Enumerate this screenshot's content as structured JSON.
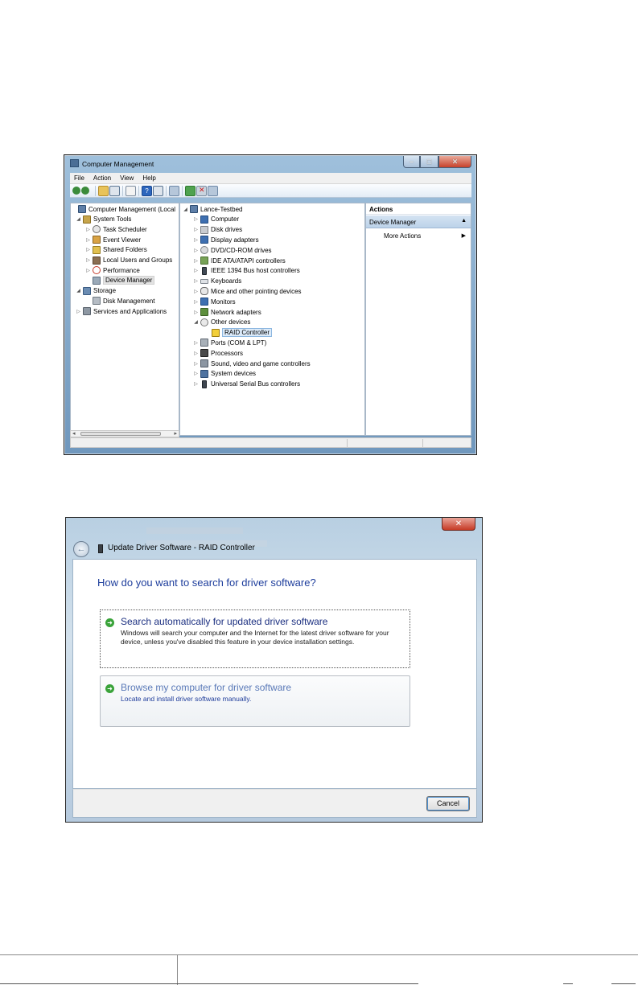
{
  "computer_management": {
    "title": "Computer Management",
    "menu": [
      "File",
      "Action",
      "View",
      "Help"
    ],
    "left_tree": [
      {
        "label": "Computer Management (Local",
        "level": 0,
        "expander": "",
        "icon": "computer-icon"
      },
      {
        "label": "System Tools",
        "level": 1,
        "expander": "◢",
        "icon": "tools-icon"
      },
      {
        "label": "Task Scheduler",
        "level": 2,
        "expander": "▷",
        "icon": "clock-icon"
      },
      {
        "label": "Event Viewer",
        "level": 2,
        "expander": "▷",
        "icon": "event-log-icon"
      },
      {
        "label": "Shared Folders",
        "level": 2,
        "expander": "▷",
        "icon": "shared-folder-icon"
      },
      {
        "label": "Local Users and Groups",
        "level": 2,
        "expander": "▷",
        "icon": "users-icon"
      },
      {
        "label": "Performance",
        "level": 2,
        "expander": "▷",
        "icon": "performance-icon"
      },
      {
        "label": "Device Manager",
        "level": 2,
        "expander": "",
        "icon": "device-manager-icon",
        "selected": true
      },
      {
        "label": "Storage",
        "level": 1,
        "expander": "◢",
        "icon": "storage-icon"
      },
      {
        "label": "Disk Management",
        "level": 2,
        "expander": "",
        "icon": "disk-management-icon"
      },
      {
        "label": "Services and Applications",
        "level": 1,
        "expander": "▷",
        "icon": "services-icon"
      }
    ],
    "device_tree": [
      {
        "label": "Lance-Testbed",
        "level": 0,
        "expander": "◢",
        "icon": "computer-icon"
      },
      {
        "label": "Computer",
        "level": 1,
        "expander": "▷",
        "icon": "monitor-icon"
      },
      {
        "label": "Disk drives",
        "level": 1,
        "expander": "▷",
        "icon": "disk-drive-icon"
      },
      {
        "label": "Display adapters",
        "level": 1,
        "expander": "▷",
        "icon": "display-adapter-icon"
      },
      {
        "label": "DVD/CD-ROM drives",
        "level": 1,
        "expander": "▷",
        "icon": "dvd-icon"
      },
      {
        "label": "IDE ATA/ATAPI controllers",
        "level": 1,
        "expander": "▷",
        "icon": "ide-controller-icon"
      },
      {
        "label": "IEEE 1394 Bus host controllers",
        "level": 1,
        "expander": "▷",
        "icon": "ieee1394-icon"
      },
      {
        "label": "Keyboards",
        "level": 1,
        "expander": "▷",
        "icon": "keyboard-icon"
      },
      {
        "label": "Mice and other pointing devices",
        "level": 1,
        "expander": "▷",
        "icon": "mouse-icon"
      },
      {
        "label": "Monitors",
        "level": 1,
        "expander": "▷",
        "icon": "monitor-icon"
      },
      {
        "label": "Network adapters",
        "level": 1,
        "expander": "▷",
        "icon": "network-adapter-icon"
      },
      {
        "label": "Other devices",
        "level": 1,
        "expander": "◢",
        "icon": "other-devices-icon"
      },
      {
        "label": "RAID Controller",
        "level": 2,
        "expander": "",
        "icon": "warning-device-icon",
        "selected": true
      },
      {
        "label": "Ports (COM & LPT)",
        "level": 1,
        "expander": "▷",
        "icon": "ports-icon"
      },
      {
        "label": "Processors",
        "level": 1,
        "expander": "▷",
        "icon": "processor-icon"
      },
      {
        "label": "Sound, video and game controllers",
        "level": 1,
        "expander": "▷",
        "icon": "sound-icon"
      },
      {
        "label": "System devices",
        "level": 1,
        "expander": "▷",
        "icon": "system-devices-icon"
      },
      {
        "label": "Universal Serial Bus controllers",
        "level": 1,
        "expander": "▷",
        "icon": "usb-controller-icon"
      }
    ],
    "actions": {
      "header": "Actions",
      "section": "Device Manager",
      "more": "More Actions"
    }
  },
  "update_driver": {
    "title": "Update Driver Software - RAID Controller",
    "question": "How do you want to search for driver software?",
    "option_auto": {
      "title": "Search automatically for updated driver software",
      "description": "Windows will search your computer and the Internet for the latest driver software for your device, unless you've disabled this feature in your device installation settings."
    },
    "option_browse": {
      "title": "Browse my computer for driver software",
      "description": "Locate and install driver software manually."
    },
    "cancel_label": "Cancel"
  }
}
